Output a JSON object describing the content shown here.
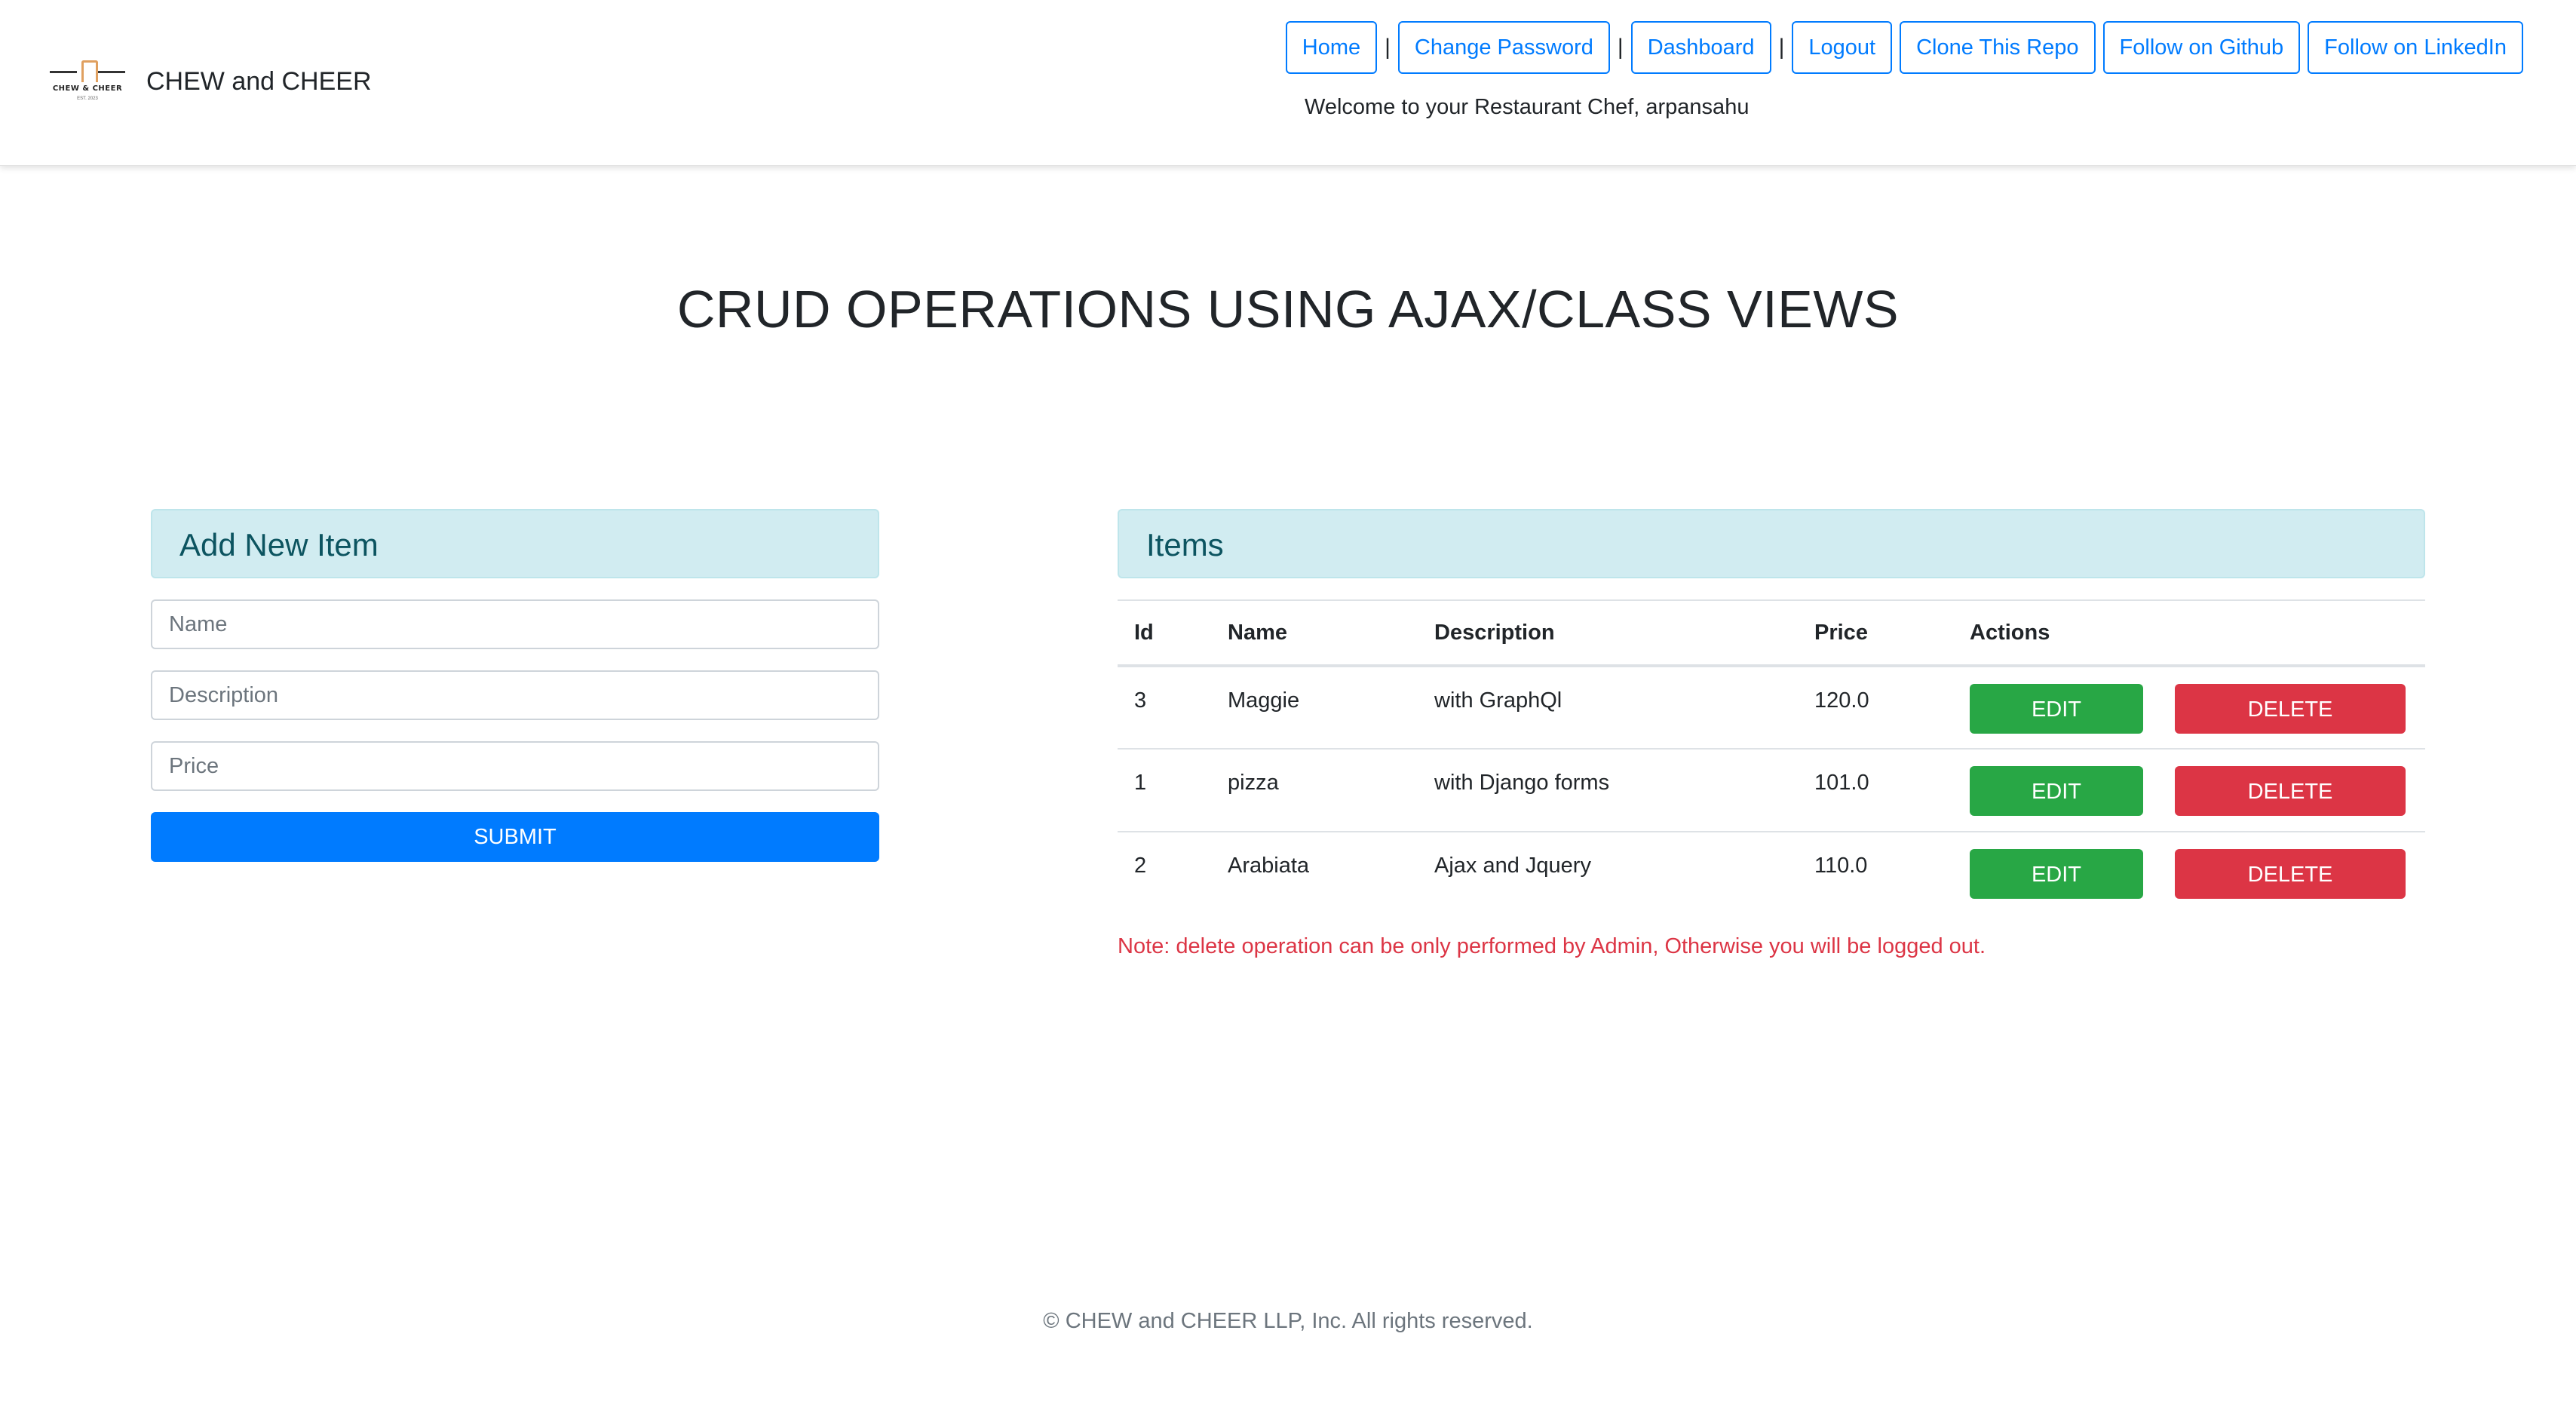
{
  "brand": {
    "logo_text": "CHEW & CHEER",
    "logo_subtext": "EST. 2023",
    "name": "CHEW and CHEER"
  },
  "nav": {
    "items": [
      {
        "label": "Home"
      },
      {
        "label": "Change Password"
      },
      {
        "label": "Dashboard"
      },
      {
        "label": "Logout"
      },
      {
        "label": "Clone This Repo"
      },
      {
        "label": "Follow on Github"
      },
      {
        "label": "Follow on LinkedIn"
      }
    ],
    "separator": "|",
    "welcome": "Welcome to your Restaurant Chef, arpansahu"
  },
  "page": {
    "title": "CRUD OPERATIONS USING AJAX/CLASS VIEWS"
  },
  "add_form": {
    "header": "Add New Item",
    "name_placeholder": "Name",
    "description_placeholder": "Description",
    "price_placeholder": "Price",
    "submit_label": "SUBMIT"
  },
  "items_table": {
    "header": "Items",
    "columns": [
      "Id",
      "Name",
      "Description",
      "Price",
      "Actions"
    ],
    "rows": [
      {
        "id": "3",
        "name": "Maggie",
        "description": "with GraphQl",
        "price": "120.0",
        "edit_label": "EDIT",
        "delete_label": "DELETE"
      },
      {
        "id": "1",
        "name": "pizza",
        "description": "with Django forms",
        "price": "101.0",
        "edit_label": "EDIT",
        "delete_label": "DELETE"
      },
      {
        "id": "2",
        "name": "Arabiata",
        "description": "Ajax and Jquery",
        "price": "110.0",
        "edit_label": "EDIT",
        "delete_label": "DELETE"
      }
    ],
    "note": "Note: delete operation can be only performed by Admin, Otherwise you will be logged out."
  },
  "footer": {
    "text": "© CHEW and CHEER LLP, Inc. All rights reserved."
  },
  "colors": {
    "primary": "#007bff",
    "success": "#28a745",
    "danger": "#dc3545",
    "info_bg": "#d1ecf1",
    "info_text": "#0c5460"
  }
}
